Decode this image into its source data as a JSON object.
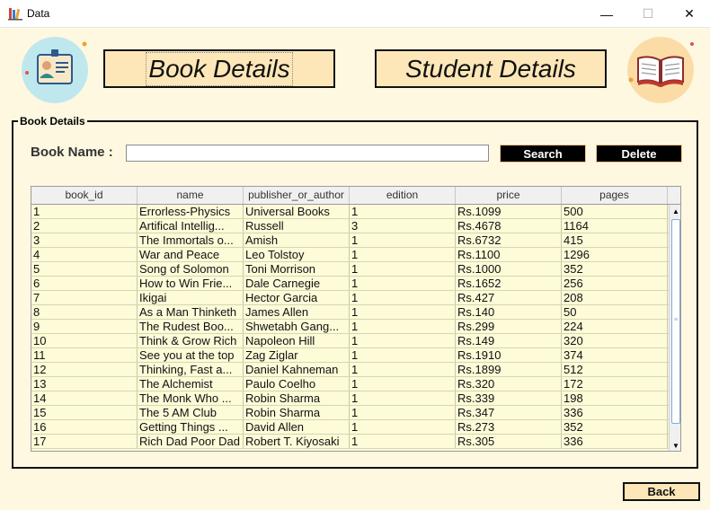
{
  "window": {
    "title": "Data",
    "minimize_glyph": "—",
    "maximize_glyph": "☐",
    "close_glyph": "✕"
  },
  "header": {
    "book_details_label": "Book Details",
    "student_details_label": "Student Details",
    "left_icon": "id-card-icon",
    "right_icon": "open-book-icon"
  },
  "panel": {
    "legend": "Book Details",
    "book_name_label": "Book Name :",
    "book_name_value": "",
    "search_label": "Search",
    "delete_label": "Delete"
  },
  "table": {
    "columns": [
      "book_id",
      "name",
      "publisher_or_author",
      "edition",
      "price",
      "pages"
    ],
    "rows": [
      [
        "1",
        "Errorless-Physics",
        "Universal Books",
        "1",
        "Rs.1099",
        "500"
      ],
      [
        "2",
        "Artifical Intellig...",
        "Russell",
        "3",
        "Rs.4678",
        "1164"
      ],
      [
        "3",
        "The Immortals o...",
        "Amish",
        "1",
        "Rs.6732",
        "415"
      ],
      [
        "4",
        "War and Peace",
        "Leo Tolstoy",
        "1",
        "Rs.1100",
        "1296"
      ],
      [
        "5",
        "Song of Solomon",
        "Toni Morrison",
        "1",
        "Rs.1000",
        "352"
      ],
      [
        "6",
        "How to Win Frie...",
        "Dale Carnegie",
        "1",
        "Rs.1652",
        "256"
      ],
      [
        "7",
        "Ikigai",
        "Hector Garcia",
        "1",
        "Rs.427",
        "208"
      ],
      [
        "8",
        "As a Man Thinketh",
        "James Allen",
        "1",
        "Rs.140",
        "50"
      ],
      [
        "9",
        "The Rudest Boo...",
        "Shwetabh Gang...",
        "1",
        "Rs.299",
        "224"
      ],
      [
        "10",
        "Think & Grow Rich",
        "Napoleon Hill",
        "1",
        "Rs.149",
        "320"
      ],
      [
        "11",
        "See you at the top",
        "Zag Ziglar",
        "1",
        "Rs.1910",
        "374"
      ],
      [
        "12",
        "Thinking, Fast a...",
        "Daniel Kahneman",
        "1",
        "Rs.1899",
        "512"
      ],
      [
        "13",
        "The Alchemist",
        "Paulo Coelho",
        "1",
        "Rs.320",
        "172"
      ],
      [
        "14",
        "The Monk Who ...",
        "Robin Sharma",
        "1",
        "Rs.339",
        "198"
      ],
      [
        "15",
        "The 5 AM Club",
        "Robin Sharma",
        "1",
        "Rs.347",
        "336"
      ],
      [
        "16",
        "Getting Things ...",
        "David Allen",
        "1",
        "Rs.273",
        "352"
      ],
      [
        "17",
        "Rich Dad Poor Dad",
        "Robert T. Kiyosaki",
        "1",
        "Rs.305",
        "336"
      ]
    ]
  },
  "footer": {
    "back_label": "Back"
  }
}
